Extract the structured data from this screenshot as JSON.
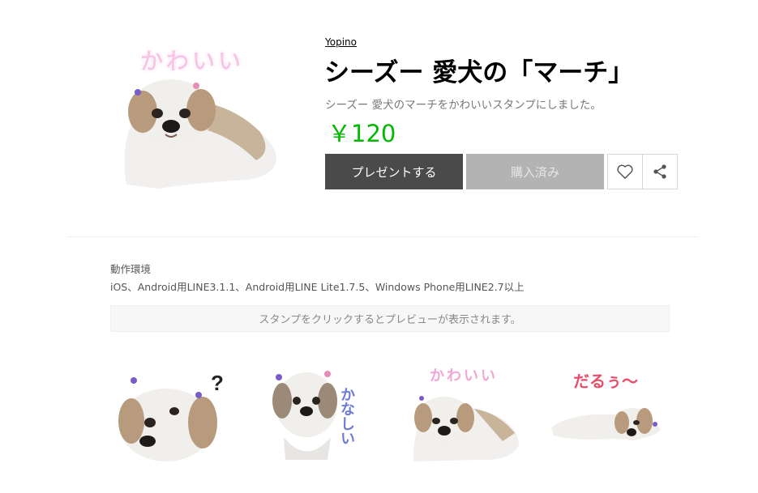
{
  "header": {
    "author": "Yopino",
    "title": "シーズー 愛犬の「マーチ」",
    "description": "シーズー 愛犬のマーチをかわいいスタンプにしました。",
    "price": "￥120"
  },
  "main_image": {
    "caption": "かわいい"
  },
  "buttons": {
    "present": "プレゼントする",
    "purchased": "購入済み",
    "like_icon": "heart-icon",
    "share_icon": "share-icon"
  },
  "environment": {
    "label": "動作環境",
    "value": "iOS、Android用LINE3.1.1、Android用LINE Lite1.7.5、Windows Phone用LINE2.7以上"
  },
  "preview_note": "スタンプをクリックするとプレビューが表示されます。",
  "stickers": [
    {
      "caption": "?"
    },
    {
      "caption": "かなしい"
    },
    {
      "caption": "かわいい"
    },
    {
      "caption": "だるぅ～"
    }
  ],
  "colors": {
    "price": "#00b900",
    "present_button": "#4a4a4a",
    "purchased_button": "#b3b3b3"
  }
}
